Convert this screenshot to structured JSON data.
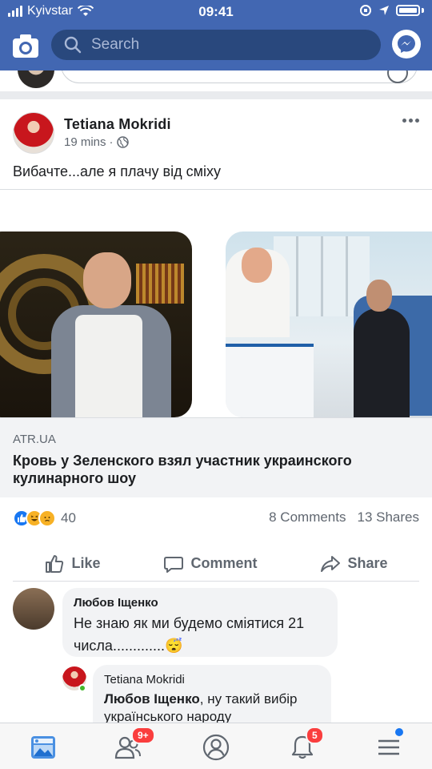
{
  "status_bar": {
    "carrier": "Kyivstar",
    "time": "09:41"
  },
  "search": {
    "placeholder": "Search"
  },
  "post": {
    "author": "Tetiana  Mokridi",
    "time": "19 mins",
    "text": "Вибачте...але я плачу від сміху",
    "link": {
      "domain": "ATR.UA",
      "headline": "Кровь у Зеленского взял участник украинского кулинарного шоу"
    },
    "reactions_count": "40",
    "comments_label": "8 Comments",
    "shares_label": "13 Shares",
    "actions": {
      "like": "Like",
      "comment": "Comment",
      "share": "Share"
    }
  },
  "comments": [
    {
      "name": "Любов Іщенко",
      "text": "Не знаю   як ми будемо сміятися 21 числа.............😴"
    },
    {
      "name": "Tetiana  Mokridi",
      "mention": "Любов Іщенко",
      "text": ", ну такий вибір українського народу"
    }
  ],
  "tabbar": {
    "friends_badge": "9+",
    "notifications_badge": "5"
  },
  "colors": {
    "brand": "#4267b2",
    "badge": "#fa3e3e",
    "like": "#1877f2"
  }
}
